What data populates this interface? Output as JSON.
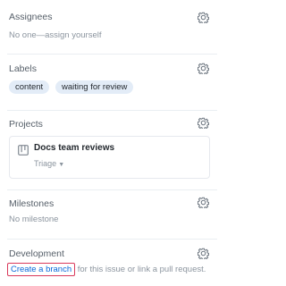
{
  "assignees": {
    "title": "Assignees",
    "empty_text": "No one—assign yourself"
  },
  "labels": {
    "title": "Labels",
    "items": [
      "content",
      "waiting for review"
    ]
  },
  "projects": {
    "title": "Projects",
    "card": {
      "name": "Docs team reviews",
      "status": "Triage"
    }
  },
  "milestones": {
    "title": "Milestones",
    "empty_text": "No milestone"
  },
  "development": {
    "title": "Development",
    "create_branch_label": "Create a branch",
    "rest_text": " for this issue or link a pull request."
  },
  "icons": {
    "settings": "gear-icon",
    "project_board": "project-board-icon",
    "dropdown": "triangle-down-icon"
  },
  "colors": {
    "link": "#0969da",
    "label_bg": "#e3ecf7",
    "highlight_border": "#d93a5c"
  }
}
